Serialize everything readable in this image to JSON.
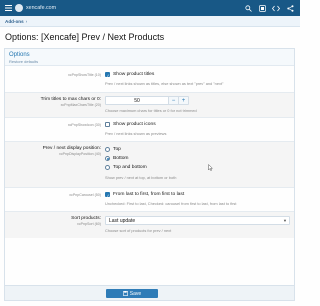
{
  "topbar": {
    "host": "xencafe.com",
    "icons": [
      "menu-icon",
      "logo-icon",
      "search-icon",
      "addon-icon",
      "code-icon",
      "share-icon"
    ]
  },
  "breadcrumb": {
    "label": "Add-ons"
  },
  "page": {
    "title": "Options: [Xencafe] Prev / Next Products"
  },
  "panel": {
    "title": "Options",
    "subtitle": "Restore defaults",
    "save_label": "Save",
    "rows": {
      "show_titles": {
        "option_id": "xcPnpShowTitle (10)",
        "option_label": "Show product titles",
        "checked": true,
        "explain": "Prev / next links shown as titles, else shown as text \"prev\" and \"next\""
      },
      "trim": {
        "label": "Trim titles to max chars or 0:",
        "option_id": "xcPnpMaxCharsTitle (20)",
        "value": "50",
        "explain": "Choose maximum chars for titles or 0 for not trimmed"
      },
      "show_icons": {
        "option_id": "xcPnpShowIcon (30)",
        "option_label": "Show product icons",
        "checked": false,
        "explain": "Prev / next links shown as previews"
      },
      "position": {
        "label": "Prev / next display position:",
        "option_id": "xcPnpDisplayPosition (40)",
        "options": [
          "Top",
          "Bottom",
          "Top and bottom"
        ],
        "selected": "Bottom",
        "explain": "Show prev / next at top, at bottom or both"
      },
      "carousel": {
        "option_id": "xcPnpCarousel (50)",
        "option_label": "From last to first, from first to last",
        "checked": true,
        "explain": "Unchecked: First to last, Checked: carousel from first to last, from last to first"
      },
      "sort": {
        "label": "Sort products:",
        "option_id": "xcPnpSort (60)",
        "value": "Last update",
        "explain": "Choose sort of products for prev / next"
      }
    }
  },
  "colors": {
    "topbar": "#185886",
    "accent": "#2577b1",
    "button": "#2f7cb7"
  }
}
